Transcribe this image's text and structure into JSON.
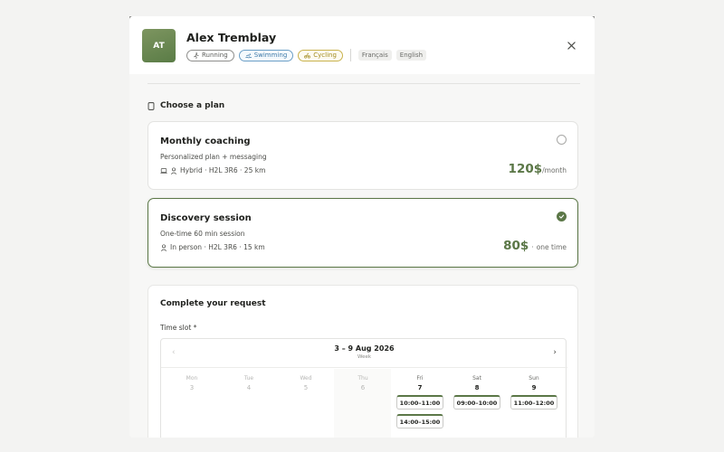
{
  "profile": {
    "initials": "AT",
    "name": "Alex Tremblay",
    "tags": [
      "Running",
      "Swimming",
      "Cycling"
    ],
    "languages": [
      "Français",
      "English"
    ]
  },
  "plans_section": {
    "title": "Choose a plan"
  },
  "plans": [
    {
      "title": "Monthly coaching",
      "description": "Personalized plan + messaging",
      "meta": "Hybrid · H2L 3R6 · 25 km",
      "price": "120$",
      "unit": "/month",
      "selected": false
    },
    {
      "title": "Discovery session",
      "description": "One-time 60 min session",
      "meta": "In person · H2L 3R6 · 15 km",
      "price": "80$",
      "separator": "·",
      "unit": "one time",
      "selected": true
    }
  ],
  "request": {
    "title": "Complete your request",
    "slot_label": "Time slot *",
    "calendar": {
      "range": "3 – 9 Aug 2026",
      "view": "Week",
      "days": [
        {
          "name": "Mon",
          "num": "3",
          "enabled": false,
          "slots": []
        },
        {
          "name": "Tue",
          "num": "4",
          "enabled": false,
          "slots": []
        },
        {
          "name": "Wed",
          "num": "5",
          "enabled": false,
          "slots": []
        },
        {
          "name": "Thu",
          "num": "6",
          "enabled": false,
          "slots": []
        },
        {
          "name": "Fri",
          "num": "7",
          "enabled": true,
          "slots": [
            "10:00–11:00",
            "14:00–15:00"
          ]
        },
        {
          "name": "Sat",
          "num": "8",
          "enabled": true,
          "slots": [
            "09:00–10:00"
          ]
        },
        {
          "name": "Sun",
          "num": "9",
          "enabled": true,
          "slots": [
            "11:00–12:00"
          ]
        }
      ]
    }
  },
  "colors": {
    "accent": "#5b7747",
    "swimming": "#3f7aa8",
    "cycling": "#a28a1e"
  },
  "icons": {
    "tags": [
      "running-icon",
      "swimming-icon",
      "cycling-icon"
    ],
    "close": "close-icon",
    "section": "document-icon",
    "plan_meta": [
      "laptop-icon",
      "person-icon"
    ]
  }
}
